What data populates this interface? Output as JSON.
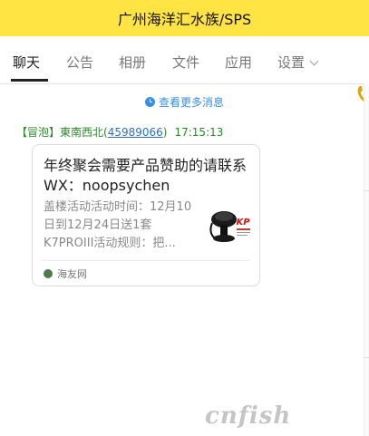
{
  "header": {
    "title": "广州海洋汇水族/SPS",
    "background_color": "#ffe443"
  },
  "tabs": [
    {
      "label": "聊天",
      "active": true
    },
    {
      "label": "公告"
    },
    {
      "label": "相册"
    },
    {
      "label": "文件"
    },
    {
      "label": "应用"
    },
    {
      "label": "设置",
      "has_dropdown": true
    }
  ],
  "toolbar": {
    "phone_icon": "phone-icon",
    "phone_color": "#e2a600"
  },
  "history": {
    "label": "查看更多消息",
    "icon": "clock-icon",
    "color": "#3a8ee6"
  },
  "message": {
    "badge": "【冒泡】",
    "sender": "東南西北",
    "uid_open": "(",
    "uid": "45989066",
    "uid_close": ")",
    "time": "17:15:13",
    "card": {
      "title": "年终聚会需要产品赞助的请联系WX：noopsychen",
      "description": "盖楼活动活动时间：12月10日到12月24日送1套K7PROIII活动规则：把...",
      "thumbnail_logo": "KP",
      "source": "海友网",
      "source_icon": "haiyou-logo-icon"
    }
  },
  "watermark": "cnfish"
}
